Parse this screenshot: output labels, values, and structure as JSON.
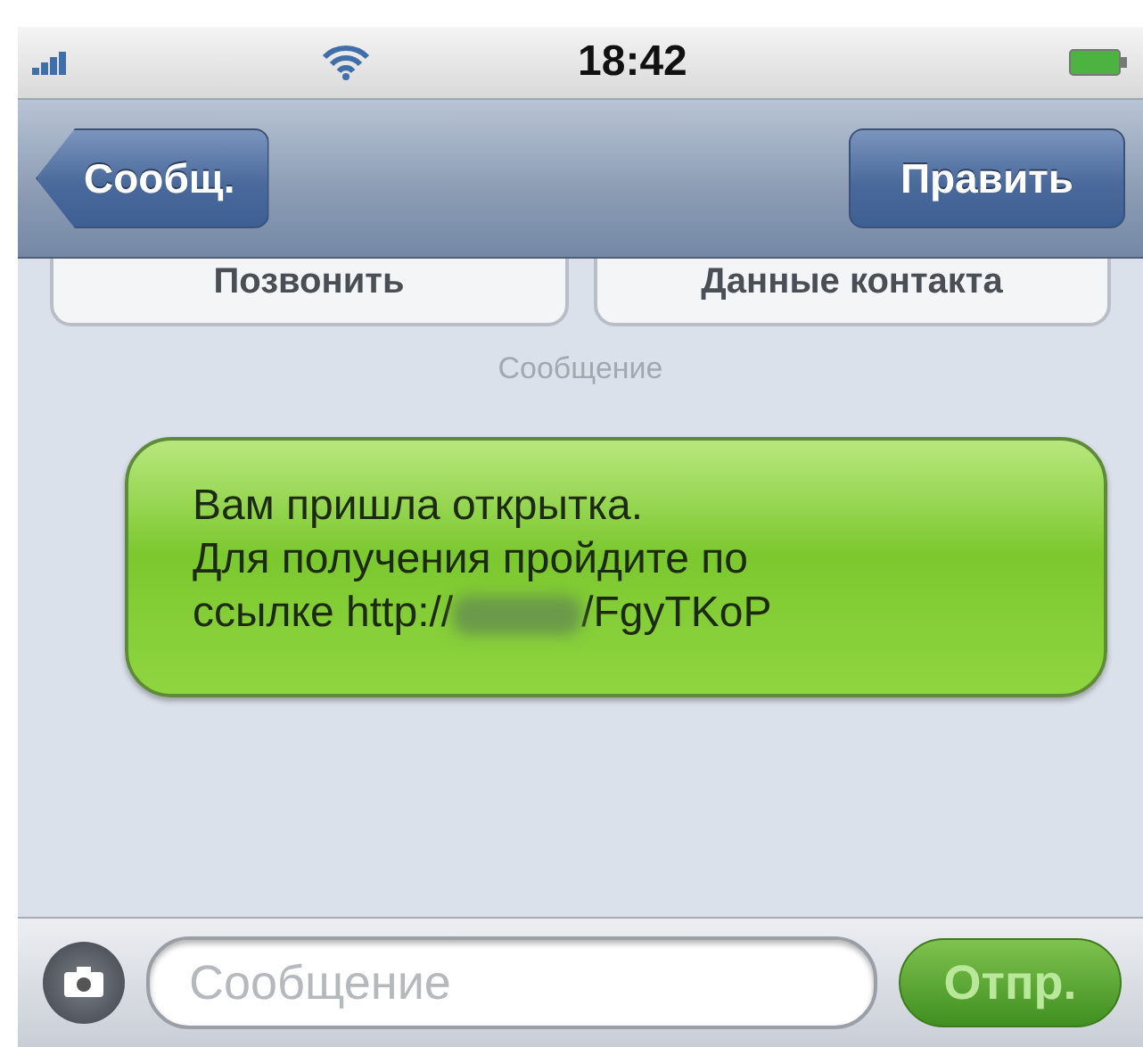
{
  "status_bar": {
    "time": "18:42"
  },
  "nav_bar": {
    "back": "Сообщ.",
    "edit": "Править"
  },
  "contact_actions": [
    "Позвонить",
    "Данные контакта"
  ],
  "timestamp": "Сообщение",
  "messages": [
    {
      "kind": "outgoing",
      "lines": [
        "Вам пришла открытка.",
        "Для получения пройдите по"
      ],
      "link_prefix": "ссылке http://",
      "link_suffix": "/FgyTKoP",
      "redacted": true
    }
  ],
  "composer": {
    "placeholder": "Сообщение",
    "send": "Отпр."
  }
}
